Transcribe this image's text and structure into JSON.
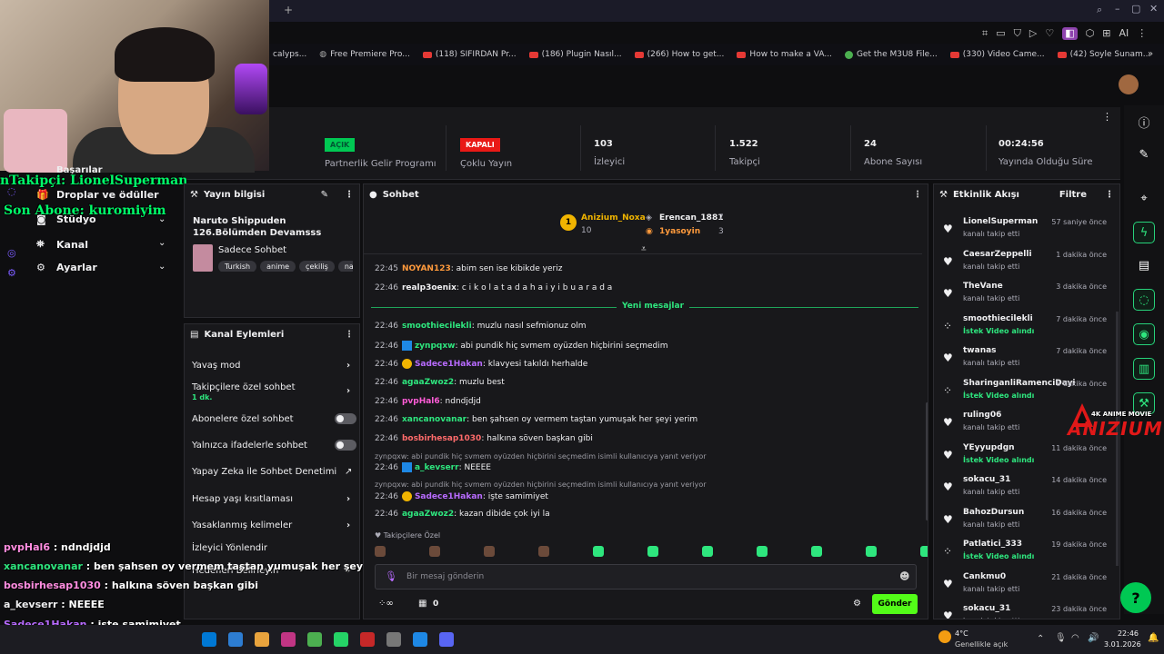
{
  "bookmarks": [
    "calyps...",
    "Free Premiere Pro...",
    "(118) SIFIRDAN Pr...",
    "(186) Plugin Nasıl...",
    "(266) How to get...",
    "How to make a VA...",
    "Get the M3U8 File...",
    "(330) Video Came...",
    "(42) Soyle Sunam..."
  ],
  "stats": {
    "partner_badge": "AÇIK",
    "partner_label": "Partnerlik Gelir Programı",
    "multi_badge": "KAPALI",
    "multi_label": "Çoklu Yayın",
    "viewers": "103",
    "viewers_label": "İzleyici",
    "followers": "1.522",
    "followers_label": "Takipçi",
    "subs": "24",
    "subs_label": "Abone Sayısı",
    "uptime": "00:24:56",
    "uptime_label": "Yayında Olduğu Süre",
    "title_fragment": "ri"
  },
  "sidebar": {
    "items": [
      {
        "label": "Başarılar"
      },
      {
        "label": "Droplar ve ödüller"
      },
      {
        "label": "Stüdyo"
      },
      {
        "label": "Kanal"
      },
      {
        "label": "Ayarlar"
      }
    ]
  },
  "overlay": {
    "last_follower": "nTakipçi: LionelSuperman",
    "last_sub": "Son Abone: kuromiyim"
  },
  "stream_info": {
    "header": "Yayın bilgisi",
    "title": "Naruto Shippuden 126.Bölümden Devamsss",
    "category": "Sadece Sohbet",
    "tags": [
      "Turkish",
      "anime",
      "çekiliş",
      "naru"
    ]
  },
  "channel_actions": {
    "header": "Kanal Eylemleri",
    "items": [
      "Yavaş mod",
      "Takipçilere özel sohbet",
      "Abonelere özel sohbet",
      "Yalnızca ifadelerle sohbet",
      "Yapay Zeka ile Sohbet Denetimi",
      "Hesap yaşı kısıtlaması",
      "Yasaklanmış kelimeler",
      "İzleyici Yönlendir",
      "Hedefleri Belirleyin"
    ],
    "followers_sub": "1 dk."
  },
  "chat": {
    "header": "Sohbet",
    "top": [
      {
        "rank": "1",
        "name": "Anizium_Noxa",
        "count": "10"
      },
      {
        "name": "Erencan_1881",
        "count": "7"
      },
      {
        "name": "1yasoyin",
        "count": "3"
      }
    ],
    "new_messages": "Yeni mesajlar",
    "messages": [
      {
        "ts": "22:45",
        "user": "NOYAN123",
        "color": "#ff9a3c",
        "text": ": abim sen ise kibikde yeriz"
      },
      {
        "ts": "22:46",
        "user": "realp3oenix",
        "color": "#efeff1",
        "text": ": c i k o l a t a d a h a i y i b u a r a d a"
      },
      {
        "ts": "22:46",
        "user": "smoothiecilekli",
        "color": "#2ee67e",
        "text": ": muzlu nasıl sefmionuz olm"
      },
      {
        "ts": "22:46",
        "user": "zynpqxw",
        "color": "#2ee67e",
        "text": ": abi pundik hiç svmem oyüzden hiçbirini seçmedim"
      },
      {
        "ts": "22:46",
        "user": "Sadece1Hakan",
        "color": "#b86bff",
        "text": ": klavyesi takıldı herhalde"
      },
      {
        "ts": "22:46",
        "user": "agaaZwoz2",
        "color": "#2ee67e",
        "text": ": muzlu best"
      },
      {
        "ts": "22:46",
        "user": "pvpHal6",
        "color": "#ff5cd7",
        "text": ": ndndjdjd"
      },
      {
        "ts": "22:46",
        "user": "xancanovanar",
        "color": "#2ee67e",
        "text": ": ben şahsen oy vermem taştan yumuşak her şeyi yerim"
      },
      {
        "ts": "22:46",
        "user": "bosbirhesap1030",
        "color": "#ff6b6b",
        "text": ": halkına söven başkan gibi"
      },
      {
        "ts": "22:46",
        "user": "a_kevserr",
        "color": "#2ee67e",
        "text": ": NEEEE"
      },
      {
        "ts": "22:46",
        "user": "Sadece1Hakan",
        "color": "#b86bff",
        "text": ": işte samimiyet"
      },
      {
        "ts": "22:46",
        "user": "agaaZwoz2",
        "color": "#2ee67e",
        "text": ": kazan dibide çok iyi la"
      }
    ],
    "reply1": "zynpqxw: abi pundik hiç svmem oyüzden hiçbirini seçmedim isimli kullanıcıya yanıt veriyor",
    "reply2": "zynpqxw: abi pundik hiç svmem oyüzden hiçbirini seçmedim isimli kullanıcıya yanıt veriyor",
    "followers_only": "Takipçilere Özel",
    "placeholder": "Bir mesaj gönderin",
    "points": "0",
    "send": "Gönder"
  },
  "activity": {
    "header": "Etkinlik Akışı",
    "filter": "Filtre",
    "items": [
      {
        "name": "LionelSuperman",
        "sub": "kanalı takip etti",
        "time": "57 saniye önce",
        "type": "follow"
      },
      {
        "name": "CaesarZeppelli",
        "sub": "kanalı takip etti",
        "time": "1 dakika önce",
        "type": "follow"
      },
      {
        "name": "TheVane",
        "sub": "kanalı takip etti",
        "time": "3 dakika önce",
        "type": "follow"
      },
      {
        "name": "smoothiecilekli",
        "sub": "İstek Video alındı",
        "time": "7 dakika önce",
        "type": "reward"
      },
      {
        "name": "twanas",
        "sub": "kanalı takip etti",
        "time": "7 dakika önce",
        "type": "follow"
      },
      {
        "name": "SharinganliRamenciDayi",
        "sub": "İstek Video alındı",
        "time": "8 dakika önce",
        "type": "reward"
      },
      {
        "name": "ruling06",
        "sub": "kanalı takip etti",
        "time": "",
        "type": "follow"
      },
      {
        "name": "YEyyupdgn",
        "sub": "İstek Video alındı",
        "time": "11 dakika önce",
        "type": "follow"
      },
      {
        "name": "sokacu_31",
        "sub": "kanalı takip etti",
        "time": "14 dakika önce",
        "type": "follow"
      },
      {
        "name": "BahozDursun",
        "sub": "kanalı takip etti",
        "time": "16 dakika önce",
        "type": "follow"
      },
      {
        "name": "Patlatici_333",
        "sub": "İstek Video alındı",
        "time": "19 dakika önce",
        "type": "reward"
      },
      {
        "name": "Cankmu0",
        "sub": "kanalı takip etti",
        "time": "21 dakika önce",
        "type": "follow"
      },
      {
        "name": "sokacu_31",
        "sub": "kanalı takip etti",
        "time": "23 dakika önce",
        "type": "follow"
      }
    ]
  },
  "logo": {
    "top": "4K ANIME MOVIE",
    "name": "ANIZIUM"
  },
  "overlay_chat": [
    {
      "user": "pvpHal6",
      "text": " : ndndjdjd",
      "color": "#ff8de0"
    },
    {
      "user": "xancanovanar",
      "text": " : ben şahsen oy vermem taştan yumuşak her şeyi yerim",
      "color": "#2ee67e"
    },
    {
      "user": "bosbirhesap1030",
      "text": " : halkına söven başkan gibi",
      "color": "#ff8de0"
    },
    {
      "user": "a_kevserr",
      "text": " : NEEEE",
      "color": "#efeff1"
    },
    {
      "user": "Sadece1Hakan",
      "text": " : işte samimiyet",
      "color": "#b86bff"
    },
    {
      "user": "agaaZwoz2",
      "text": " : kazan dibide çok iyi la",
      "color": "#2ee67e"
    }
  ],
  "taskbar": {
    "weather": "4°C",
    "weather_sub": "Genellikle açık",
    "time": "22:46",
    "date": "3.01.2026"
  }
}
